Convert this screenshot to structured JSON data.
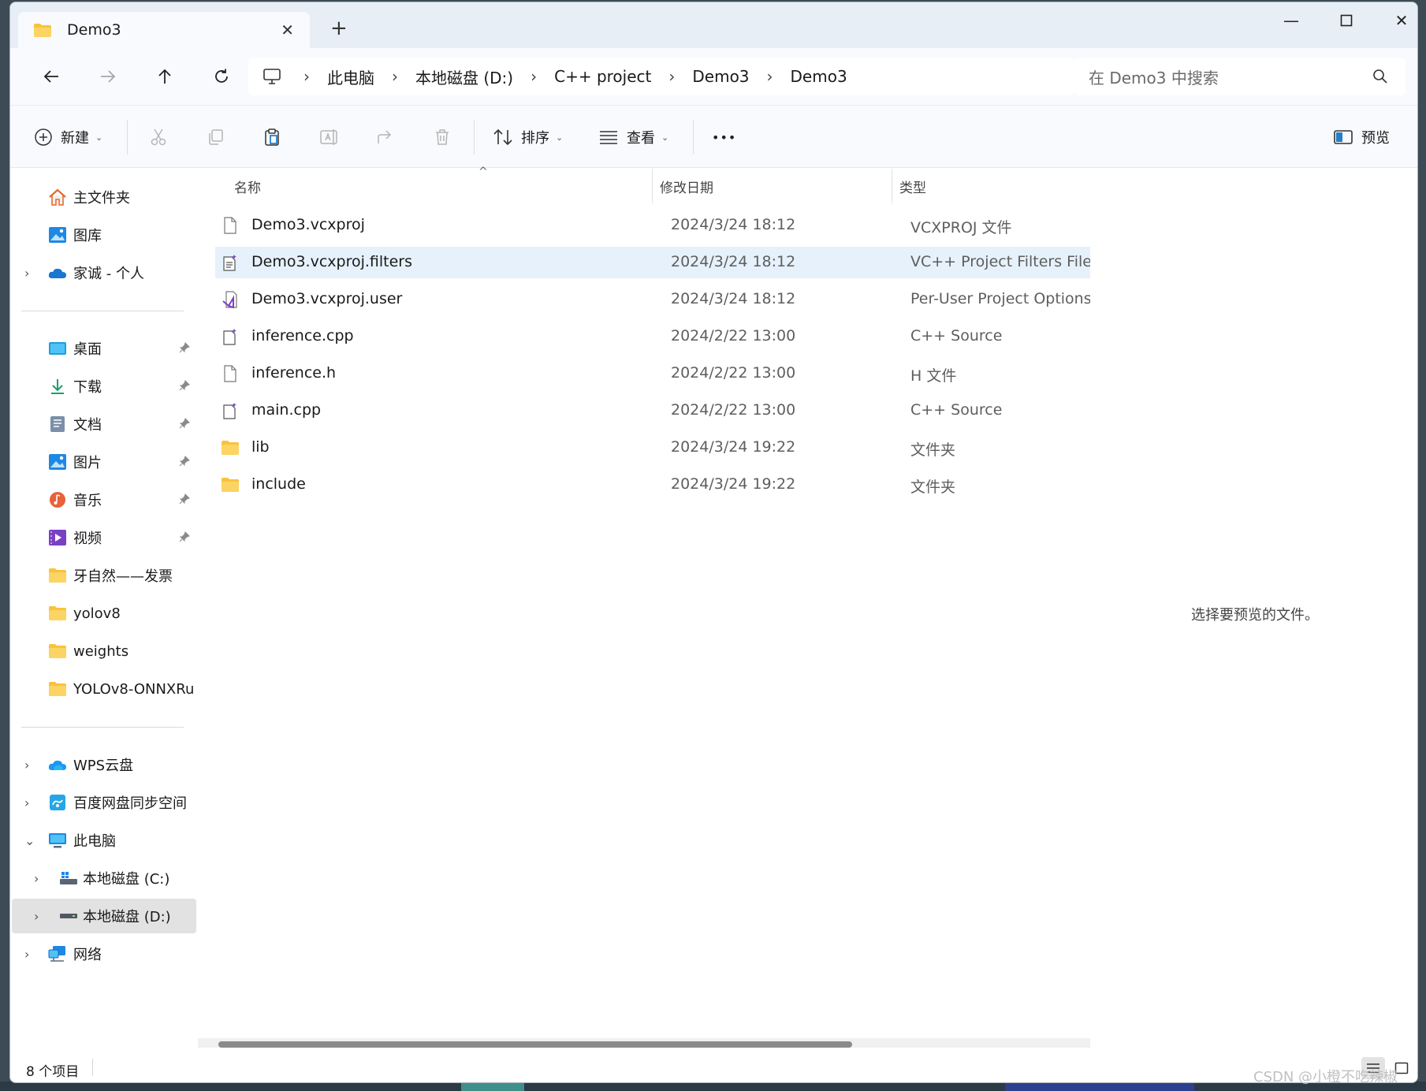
{
  "tab": {
    "title": "Demo3"
  },
  "address": {
    "crumbs": [
      "此电脑",
      "本地磁盘 (D:)",
      "C++ project",
      "Demo3",
      "Demo3"
    ]
  },
  "search": {
    "placeholder": "在 Demo3 中搜索"
  },
  "commands": {
    "new_label": "新建",
    "sort_label": "排序",
    "view_label": "查看",
    "more_label": "•••",
    "preview_label": "预览"
  },
  "sidebar": {
    "top": [
      {
        "label": "主文件夹",
        "icon": "home-icon"
      },
      {
        "label": "图库",
        "icon": "gallery-icon"
      },
      {
        "label": "家诚 - 个人",
        "icon": "onedrive-icon"
      }
    ],
    "quick": [
      {
        "label": "桌面",
        "icon": "desktop-icon",
        "pinned": true
      },
      {
        "label": "下载",
        "icon": "download-icon",
        "pinned": true
      },
      {
        "label": "文档",
        "icon": "documents-icon",
        "pinned": true
      },
      {
        "label": "图片",
        "icon": "pictures-icon",
        "pinned": true
      },
      {
        "label": "音乐",
        "icon": "music-icon",
        "pinned": true
      },
      {
        "label": "视频",
        "icon": "videos-icon",
        "pinned": true
      },
      {
        "label": "牙自然——发票",
        "icon": "folder-icon",
        "pinned": false
      },
      {
        "label": "yolov8",
        "icon": "folder-icon",
        "pinned": false
      },
      {
        "label": "weights",
        "icon": "folder-icon",
        "pinned": false
      },
      {
        "label": "YOLOv8-ONNXRu",
        "icon": "folder-icon",
        "pinned": false
      }
    ],
    "bottom": [
      {
        "label": "WPS云盘",
        "icon": "wps-cloud-icon"
      },
      {
        "label": "百度网盘同步空间",
        "icon": "baidu-netdisk-icon"
      },
      {
        "label": "此电脑",
        "icon": "this-pc-icon"
      },
      {
        "label": "本地磁盘 (C:)",
        "icon": "drive-c-icon"
      },
      {
        "label": "本地磁盘 (D:)",
        "icon": "drive-d-icon"
      },
      {
        "label": "网络",
        "icon": "network-icon"
      }
    ]
  },
  "columns": {
    "name": "名称",
    "date": "修改日期",
    "type": "类型"
  },
  "files": [
    {
      "name": "Demo3.vcxproj",
      "date": "2024/3/24 18:12",
      "type": "VCXPROJ 文件",
      "icon": "file-icon"
    },
    {
      "name": "Demo3.vcxproj.filters",
      "date": "2024/3/24 18:12",
      "type": "VC++ Project Filters File",
      "icon": "filters-file-icon"
    },
    {
      "name": "Demo3.vcxproj.user",
      "date": "2024/3/24 18:12",
      "type": "Per-User Project Options File",
      "icon": "vs-user-file-icon"
    },
    {
      "name": "inference.cpp",
      "date": "2024/2/22 13:00",
      "type": "C++ Source",
      "icon": "cpp-file-icon"
    },
    {
      "name": "inference.h",
      "date": "2024/2/22 13:00",
      "type": "H 文件",
      "icon": "file-icon"
    },
    {
      "name": "main.cpp",
      "date": "2024/2/22 13:00",
      "type": "C++ Source",
      "icon": "cpp-file-icon"
    },
    {
      "name": "lib",
      "date": "2024/3/24 19:22",
      "type": "文件夹",
      "icon": "folder-icon"
    },
    {
      "name": "include",
      "date": "2024/3/24 19:22",
      "type": "文件夹",
      "icon": "folder-icon"
    }
  ],
  "preview": {
    "message": "选择要预览的文件。"
  },
  "status": {
    "count": "8 个项目"
  },
  "watermark": "CSDN @小橙不吃辣椒",
  "colors": {
    "accent": "#0067c0",
    "folder": "#f8c33c",
    "selected_row": "#e6f1fb"
  }
}
